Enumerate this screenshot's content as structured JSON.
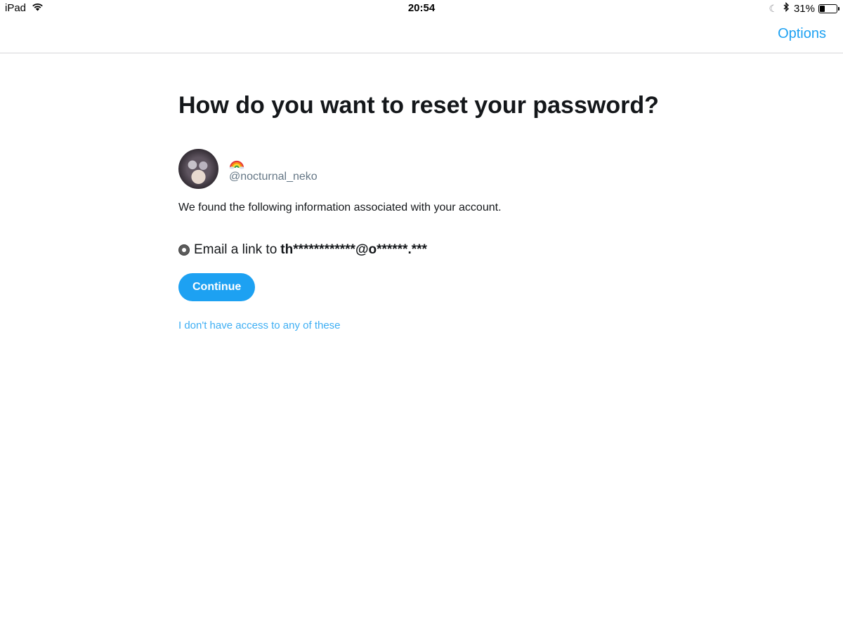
{
  "status_bar": {
    "carrier": "iPad",
    "time": "20:54",
    "battery_percent_label": "31%",
    "battery_level": 0.31
  },
  "nav": {
    "options_label": "Options"
  },
  "main": {
    "title": "How do you want to reset your password?",
    "account": {
      "display_name_emoji": "rainbow",
      "handle": "@nocturnal_neko"
    },
    "found_text": "We found the following information associated with your account.",
    "option": {
      "label": "Email a link to",
      "email": "th************@o******.***",
      "selected": true
    },
    "continue_label": "Continue",
    "no_access_label": "I don't have access to any of these"
  },
  "colors": {
    "accent": "#1da1f2",
    "text": "#14171a",
    "secondary_text": "#657786",
    "divider": "#d5d5d8"
  }
}
